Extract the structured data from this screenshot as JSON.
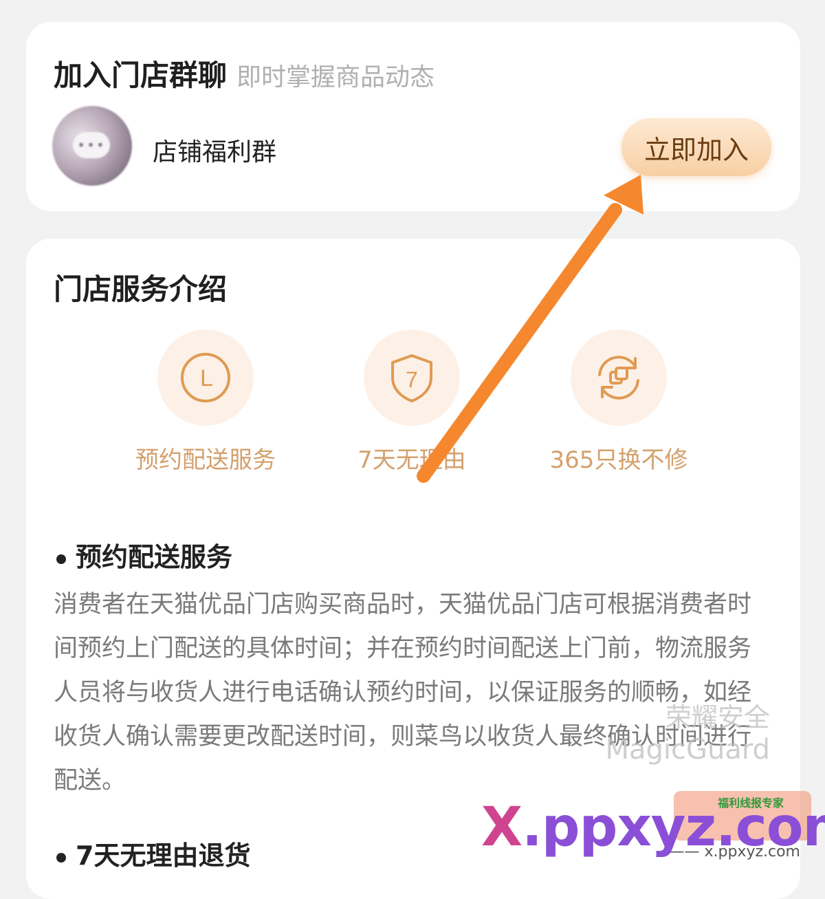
{
  "group": {
    "title": "加入门店群聊",
    "subtitle": "即时掌握商品动态",
    "name": "店铺福利群",
    "avatar_glyph": "•••",
    "join_label": "立即加入"
  },
  "service": {
    "title": "门店服务介绍",
    "features": [
      {
        "label": "预约配送服务",
        "icon": "clock-icon",
        "glyph": "L"
      },
      {
        "label": "7天无理由",
        "icon": "shield-7-icon",
        "glyph": "7"
      },
      {
        "label": "365只换不修",
        "icon": "exchange-icon"
      }
    ],
    "sections": [
      {
        "heading": "预约配送服务",
        "body": "消费者在天猫优品门店购买商品时，天猫优品门店可根据消费者时间预约上门配送的具体时间；并在预约时间配送上门前，物流服务人员将与收货人进行电话确认预约时间，以保证服务的顺畅，如经收货人确认需要更改配送时间，则菜鸟以收货人最终确认时间进行配送。"
      },
      {
        "heading": "7天无理由退货"
      }
    ]
  },
  "watermarks": {
    "magic_cn": "荣耀安全",
    "magic_en": "MagicGuard",
    "site_big_x": "X",
    "site_big_rest": ".ppxyz.com",
    "site_small": "—— x.ppxyz.com",
    "badge_text": "福利线报专家"
  },
  "colors": {
    "accent": "#d4a06c",
    "button_bg": "#f8cfa4",
    "arrow": "#f5882f"
  }
}
